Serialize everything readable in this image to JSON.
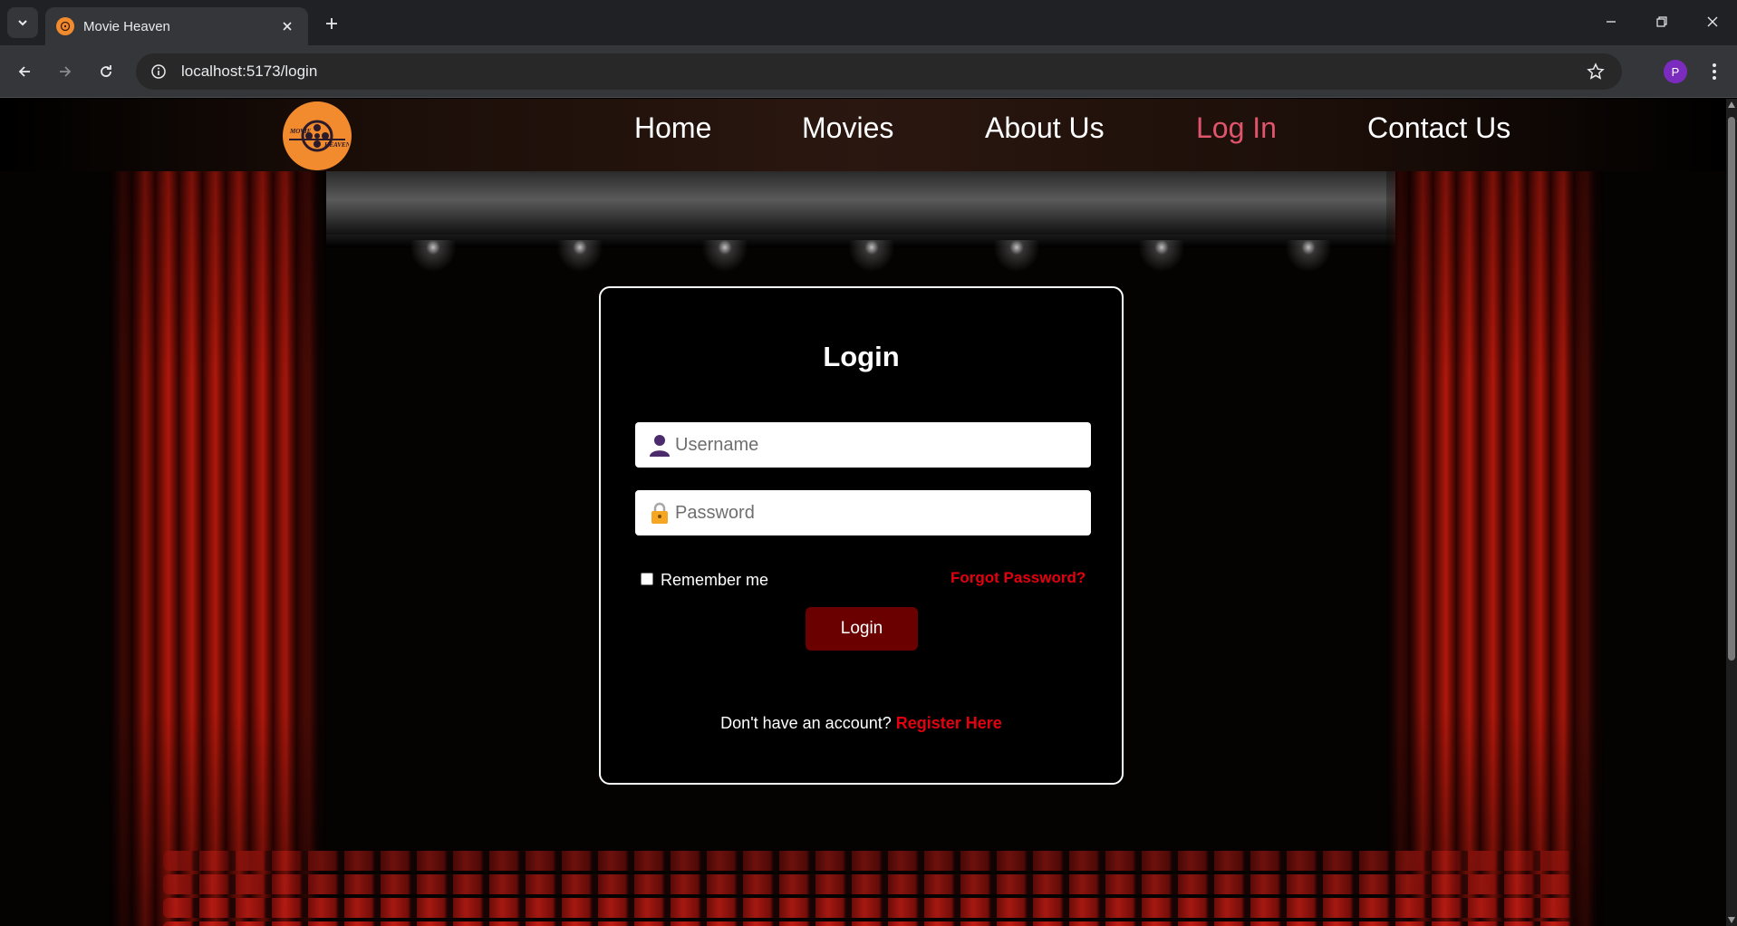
{
  "browser": {
    "tab_title": "Movie Heaven",
    "url": "localhost:5173/login",
    "profile_initial": "P",
    "icons": [
      "tab-list-icon",
      "close-icon",
      "plus-icon",
      "minimize-icon",
      "restore-icon",
      "window-close-icon",
      "back-icon",
      "forward-icon",
      "reload-icon",
      "site-info-icon",
      "star-icon",
      "menu-dots-icon"
    ]
  },
  "site": {
    "logo_alt": "movie-heaven-logo",
    "nav": {
      "home": "Home",
      "movies": "Movies",
      "about": "About Us",
      "login": "Log In",
      "contact": "Contact Us"
    },
    "active_nav": "login",
    "colors": {
      "accent_logo": "#f28a2e",
      "active_nav": "#e0556b",
      "link_red": "#e3000f",
      "button_bg": "#6b0000"
    }
  },
  "login": {
    "title": "Login",
    "username_placeholder": "Username",
    "password_placeholder": "Password",
    "remember_label": "Remember me",
    "forgot_label": "Forgot Password?",
    "submit_label": "Login",
    "register_prompt": "Don't have an account?",
    "register_link": "Register Here"
  }
}
